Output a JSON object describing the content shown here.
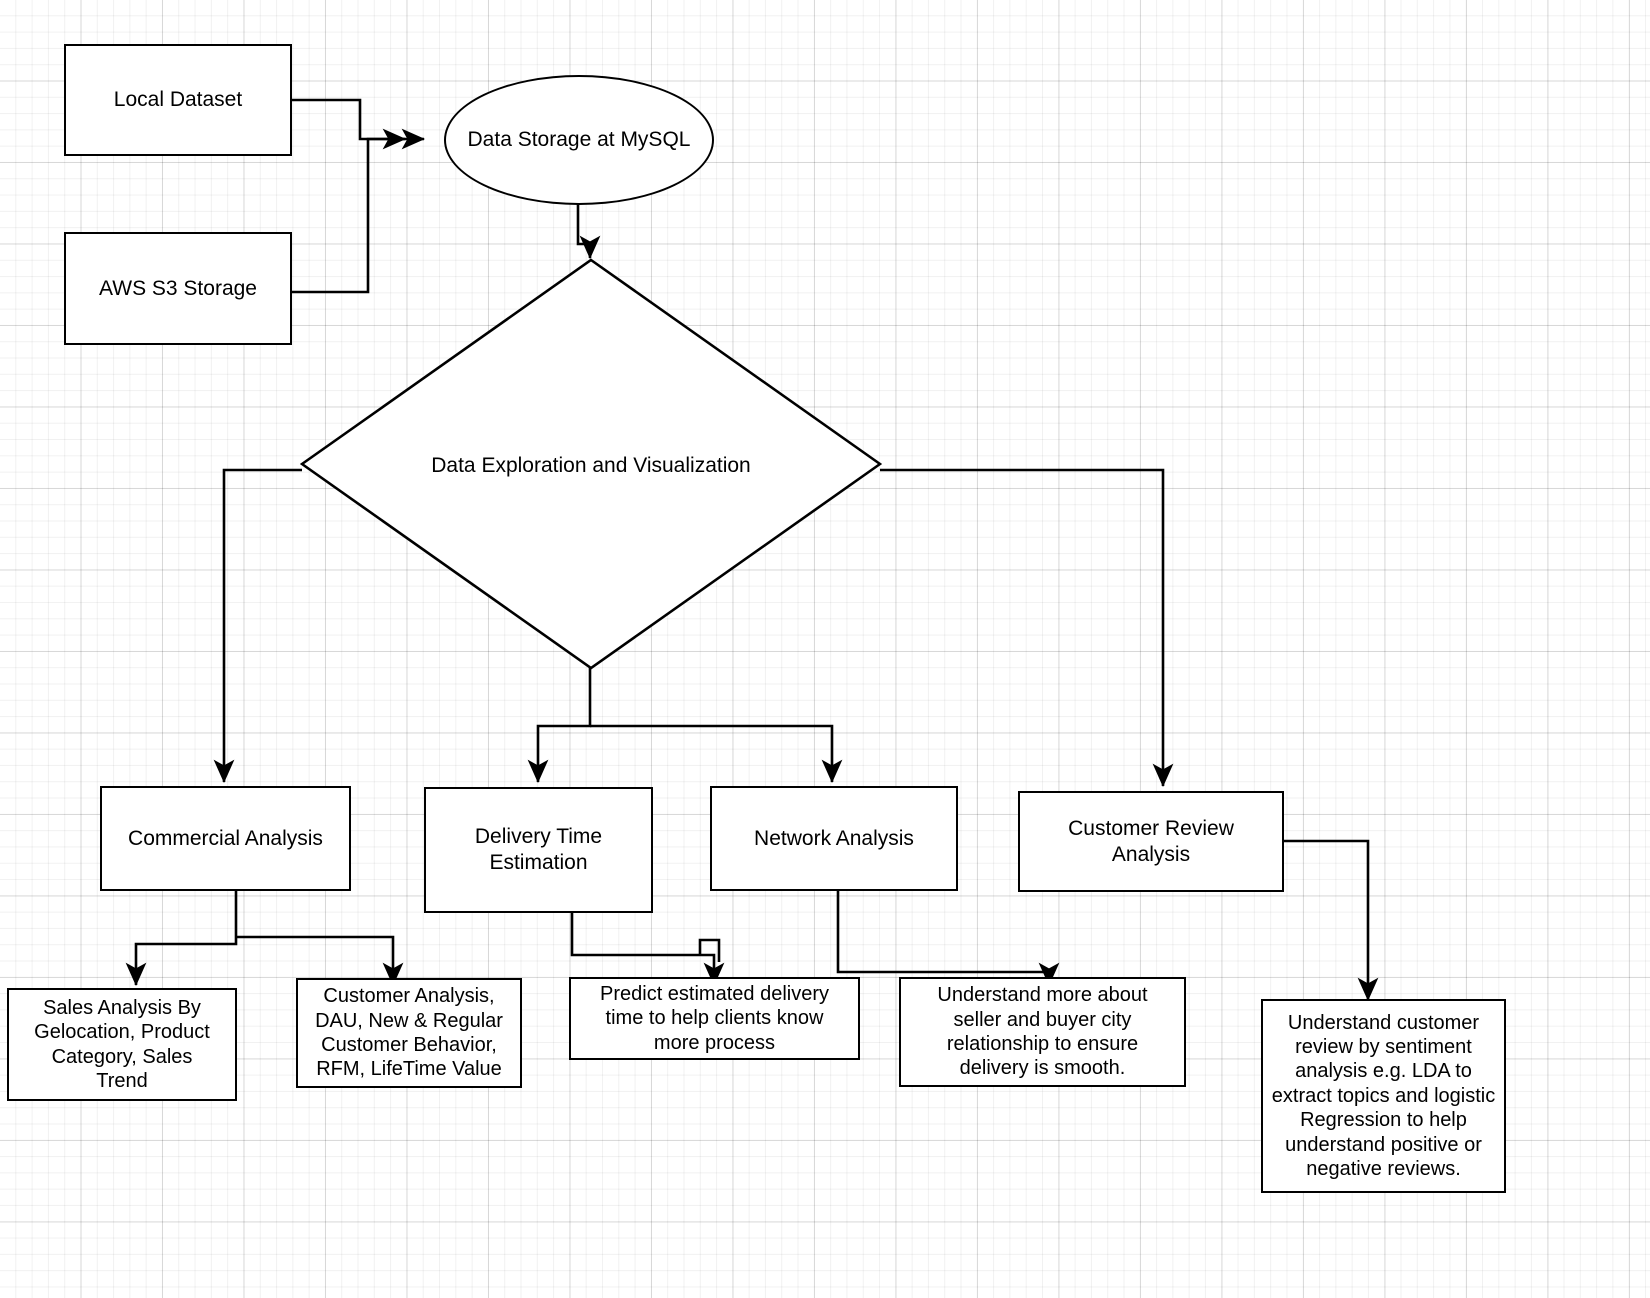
{
  "diagram": {
    "title": "E-commerce Data Analytics Pipeline Flowchart",
    "background": "#ffffff",
    "line_color": "#000000",
    "node_fill": "#ffffff",
    "grid": true
  },
  "nodes": {
    "local_dataset": {
      "label": "Local Dataset",
      "shape": "rectangle"
    },
    "aws_s3_storage": {
      "label": "AWS S3 Storage",
      "shape": "rectangle"
    },
    "data_storage_mysql": {
      "label": "Data Storage at MySQL",
      "shape": "ellipse"
    },
    "data_exploration": {
      "label": "Data Exploration and Visualization",
      "shape": "diamond"
    },
    "commercial_analysis": {
      "label": "Commercial Analysis",
      "shape": "rectangle"
    },
    "delivery_time_estimation": {
      "label": "Delivery Time\nEstimation",
      "shape": "rectangle"
    },
    "network_analysis": {
      "label": "Network Analysis",
      "shape": "rectangle"
    },
    "customer_review_analysis": {
      "label": "Customer Review\nAnalysis",
      "shape": "rectangle"
    },
    "sales_analysis": {
      "label": "Sales Analysis By\nGelocation, Product\nCategory, Sales\nTrend",
      "shape": "rectangle"
    },
    "customer_analysis": {
      "label": "Customer Analysis,\nDAU, New & Regular\nCustomer Behavior,\nRFM, LifeTime Value",
      "shape": "rectangle"
    },
    "predict_delivery": {
      "label": "Predict estimated delivery\ntime to help clients know\nmore process",
      "shape": "rectangle"
    },
    "seller_buyer_city": {
      "label": "Understand more about\nseller and buyer city\nrelationship to ensure\ndelivery is smooth.",
      "shape": "rectangle"
    },
    "sentiment_review": {
      "label": "Understand customer\nreview by sentiment\nanalysis e.g. LDA to\nextract topics and logistic\nRegression to help\nunderstand positive or\nnegative reviews.",
      "shape": "rectangle"
    }
  },
  "edges": [
    {
      "from": "local_dataset",
      "to": "data_storage_mysql"
    },
    {
      "from": "aws_s3_storage",
      "to": "data_storage_mysql"
    },
    {
      "from": "data_storage_mysql",
      "to": "data_exploration"
    },
    {
      "from": "data_exploration",
      "to": "commercial_analysis"
    },
    {
      "from": "data_exploration",
      "to": "delivery_time_estimation"
    },
    {
      "from": "data_exploration",
      "to": "network_analysis"
    },
    {
      "from": "data_exploration",
      "to": "customer_review_analysis"
    },
    {
      "from": "commercial_analysis",
      "to": "sales_analysis"
    },
    {
      "from": "commercial_analysis",
      "to": "customer_analysis"
    },
    {
      "from": "delivery_time_estimation",
      "to": "predict_delivery"
    },
    {
      "from": "network_analysis",
      "to": "seller_buyer_city"
    },
    {
      "from": "customer_review_analysis",
      "to": "sentiment_review"
    }
  ]
}
